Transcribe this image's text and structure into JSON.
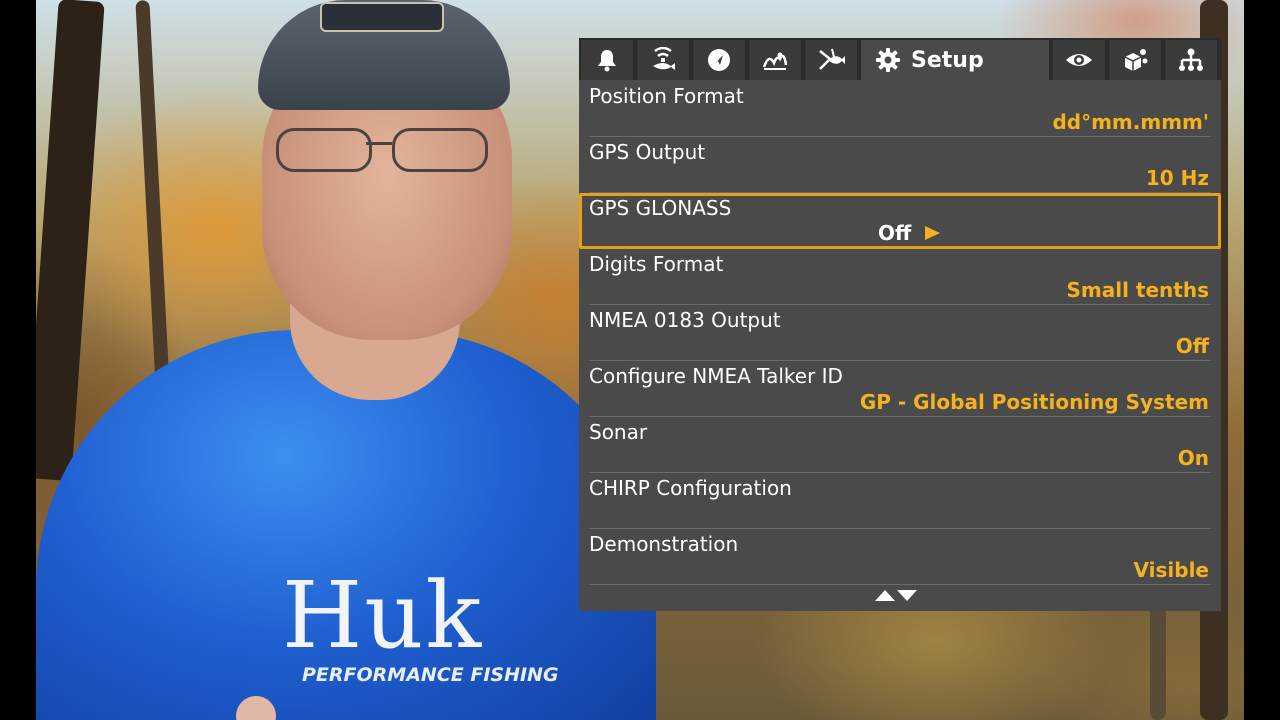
{
  "tabs": [
    {
      "icon": "alarm-bell-icon"
    },
    {
      "icon": "sonar-fish-icon"
    },
    {
      "icon": "navigation-compass-icon"
    },
    {
      "icon": "chart-map-icon"
    },
    {
      "icon": "fish-finder-icon"
    },
    {
      "icon": "gear-icon",
      "label": "Setup",
      "active": true
    },
    {
      "icon": "eye-view-icon"
    },
    {
      "icon": "accessories-icon"
    },
    {
      "icon": "network-icon"
    }
  ],
  "menu": [
    {
      "label": "Position Format",
      "value": "dd°mm.mmm'"
    },
    {
      "label": "GPS Output",
      "value": "10 Hz"
    },
    {
      "label": "GPS GLONASS",
      "value": "Off",
      "selected": true
    },
    {
      "label": "Digits Format",
      "value": "Small tenths"
    },
    {
      "label": "NMEA 0183 Output",
      "value": "Off"
    },
    {
      "label": "Configure NMEA Talker ID",
      "value": "GP - Global Positioning System"
    },
    {
      "label": "Sonar",
      "value": "On"
    },
    {
      "label": "CHIRP Configuration",
      "value": ""
    },
    {
      "label": "Demonstration",
      "value": "Visible"
    }
  ],
  "scroll_indicator": "up-down-arrows-icon",
  "shirt_brand": "Huk",
  "shirt_tagline": "PERFORMANCE FISHING",
  "colors": {
    "panel_bg": "#4a4a4a",
    "tab_bg": "#3b3b3b",
    "value_accent": "#f5b21c",
    "selection_border": "#e3a11b",
    "label_text": "#ffffff"
  }
}
